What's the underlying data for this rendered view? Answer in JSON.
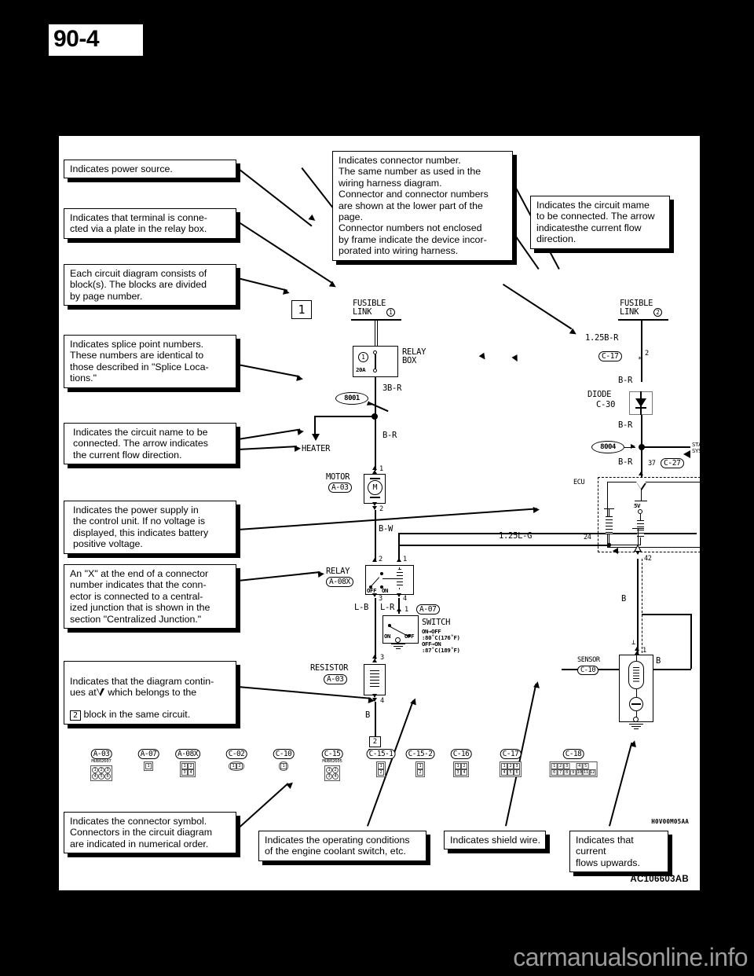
{
  "page": {
    "number": "90-4",
    "figure_code": "AC106603AB",
    "drawing_code": "H0V00M05AA",
    "watermark": "carmanualsonline.info"
  },
  "callouts": {
    "power_source": "Indicates power source.",
    "terminal_plate": "Indicates that terminal is conne-\ncted via a plate in the relay box.",
    "block_pages": "Each circuit diagram consists of\nblock(s). The blocks are divided\nby page number.",
    "splice_points": "Indicates splice point numbers.\nThese numbers are identical to\nthose described in \"Splice Loca-\ntions.\"",
    "circuit_name_left": "Indicates the circuit name to be\nconnected. The arrow indicates\nthe current flow direction.",
    "power_supply_unit": "Indicates the power supply in\nthe control unit. If no voltage is\ndisplayed, this indicates battery\npositive voltage.",
    "x_suffix": "An \"X\" at the end of a connector\nnumber indicates that the conn-\nector is connected to a central-\nized junction that is shown in the\nsection \"Centralized Junction.\"",
    "continues_prefix": "Indicates that the diagram contin-\nues at",
    "continues_middle": "which belongs to the",
    "continues_suffix": "block in the same circuit.",
    "continues_block_num": "2",
    "connector_symbol": "Indicates the connector symbol.\nConnectors in the circuit diagram\nare indicated in numerical order.",
    "connector_number": "Indicates connector number.\nThe same number as used in the\nwiring harness diagram.\nConnector and connector numbers\nare shown at the lower part of the\npage.\nConnector numbers not enclosed\nby frame indicate the device incor-\nporated into wiring harness.",
    "circuit_name_right": "Indicates the circuit mame\nto be connected. The arrow\nindicatesthe current flow\ndirection.",
    "operating_conditions": "Indicates the operating conditions\nof the engine coolant switch, etc.",
    "shield_wire": "Indicates shield wire.",
    "current_upwards": "Indicates that current\nflows upwards."
  },
  "diagram": {
    "block_number": "1",
    "left_branch": {
      "fusible_link_label": "FUSIBLE\nLINK",
      "fusible_link_num": "1",
      "relay_box_label": "RELAY\nBOX",
      "fuse_num": "1",
      "fuse_rating": "20A",
      "wire_3br": "3B-R",
      "splice": "8001",
      "heater_label": "HEATER",
      "wire_br": "B-R",
      "motor_label": "MOTOR",
      "motor_conn": "A-03",
      "motor_symbol": "M",
      "motor_pin_top": "1",
      "motor_pin_bottom": "2",
      "wire_bw": "B-W",
      "relay_label": "RELAY",
      "relay_conn": "A-08X",
      "relay_pin_2": "2",
      "relay_pin_1": "1",
      "relay_pin_3": "3",
      "relay_pin_4": "4",
      "relay_off": "OFF",
      "relay_on": "ON",
      "wire_lb": "L-B",
      "wire_lr": "L-R",
      "switch_label": "SWITCH",
      "switch_conn": "A-07",
      "switch_pin_1": "1",
      "switch_on": "ON",
      "switch_off": "OFF",
      "switch_cond_1": "ON→OFF",
      "switch_cond_1_temp": ":80˚C(176˚F)",
      "switch_cond_2": "OFF→ON",
      "switch_cond_2_temp": ":87˚C(189˚F)",
      "resistor_label": "RESISTOR",
      "resistor_conn": "A-03",
      "resistor_pin_3": "3",
      "resistor_pin_4": "4",
      "wire_b": "B",
      "continue_block": "2"
    },
    "right_branch": {
      "fusible_link_label": "FUSIBLE\nLINK",
      "fusible_link_num": "2",
      "wire_125br": "1.25B-R",
      "conn_c17": "C-17",
      "c17_pin": "2",
      "wire_br_1": "B-R",
      "diode_label": "DIODE",
      "diode_conn": "C-30",
      "wire_br_2": "B-R",
      "splice": "8004",
      "starting_system": "STARTING\nSYSTEM",
      "wire_br_3": "B-R",
      "c27_pin": "37",
      "conn_c27": "C-27",
      "ecu_label": "ECU",
      "ecu_voltage": "5V",
      "ecu_pin_24": "24",
      "ecu_pin_42": "42",
      "wire_125lg": "1.25L-G",
      "wire_b_shield": "B",
      "sensor_label": "SENSOR",
      "sensor_conn": "C-10",
      "sensor_pin_1": "1",
      "wire_b_right": "B"
    }
  },
  "connectors": [
    {
      "id": "A-03",
      "part": "MU802607",
      "rows": [
        [
          "1",
          "2",
          "3"
        ],
        [
          "4",
          "5",
          "6"
        ]
      ],
      "shape": "round"
    },
    {
      "id": "A-07",
      "part": "",
      "rows": [
        [
          "1"
        ]
      ],
      "shape": "tab"
    },
    {
      "id": "A-08X",
      "part": "",
      "rows": [
        [
          "1",
          "2"
        ],
        [
          "3",
          "4"
        ]
      ],
      "shape": "square"
    },
    {
      "id": "C-02",
      "part": "",
      "rows": [
        [
          "1",
          "2"
        ]
      ],
      "shape": "oval"
    },
    {
      "id": "C-10",
      "part": "",
      "rows": [
        [
          "1"
        ]
      ],
      "shape": "oval"
    },
    {
      "id": "C-15",
      "part": "MU802605",
      "rows": [
        [
          "1",
          "2"
        ],
        [
          "3",
          "4"
        ]
      ],
      "shape": "round"
    },
    {
      "id": "C-15-1",
      "part": "",
      "rows": [
        [
          "1"
        ],
        [
          "2"
        ]
      ],
      "shape": "square"
    },
    {
      "id": "C-15-2",
      "part": "",
      "rows": [
        [
          "1"
        ],
        [
          "2"
        ]
      ],
      "shape": "square"
    },
    {
      "id": "C-16",
      "part": "",
      "rows": [
        [
          "1",
          "2"
        ],
        [
          "3",
          "4"
        ]
      ],
      "shape": "square"
    },
    {
      "id": "C-17",
      "part": "",
      "rows": [
        [
          "1",
          "2",
          "3"
        ],
        [
          "4",
          "5",
          "6"
        ]
      ],
      "shape": "square"
    },
    {
      "id": "C-18",
      "part": "",
      "rows": [
        [
          "1",
          "2",
          "3",
          "",
          "4",
          "5"
        ],
        [
          "6",
          "7",
          "8",
          "9",
          "10",
          "11",
          "12"
        ]
      ],
      "shape": "square"
    }
  ]
}
